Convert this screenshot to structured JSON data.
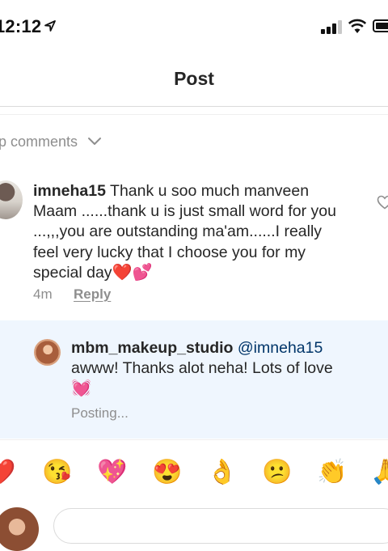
{
  "status_bar": {
    "time": "12:12"
  },
  "nav": {
    "title": "Post"
  },
  "section": {
    "top_comments_label": "op comments"
  },
  "comment": {
    "username": "imneha15",
    "text": " Thank u soo much manveen Maam ......thank u is just small word for you ...,,,you are outstanding ma'am......I really feel very lucky that I choose you for my special day",
    "emojis": "❤️💕",
    "time": "4m",
    "reply_label": "Reply"
  },
  "reply": {
    "username": "mbm_makeup_studio",
    "mention": "@imneha15",
    "text": "awww! Thanks alot neha! Lots of love",
    "emoji": "💓",
    "status": "Posting..."
  },
  "emoji_bar": {
    "items": [
      "❤️",
      "😘",
      "💖",
      "😍",
      "👌",
      "😕",
      "👏",
      "🙏"
    ]
  }
}
